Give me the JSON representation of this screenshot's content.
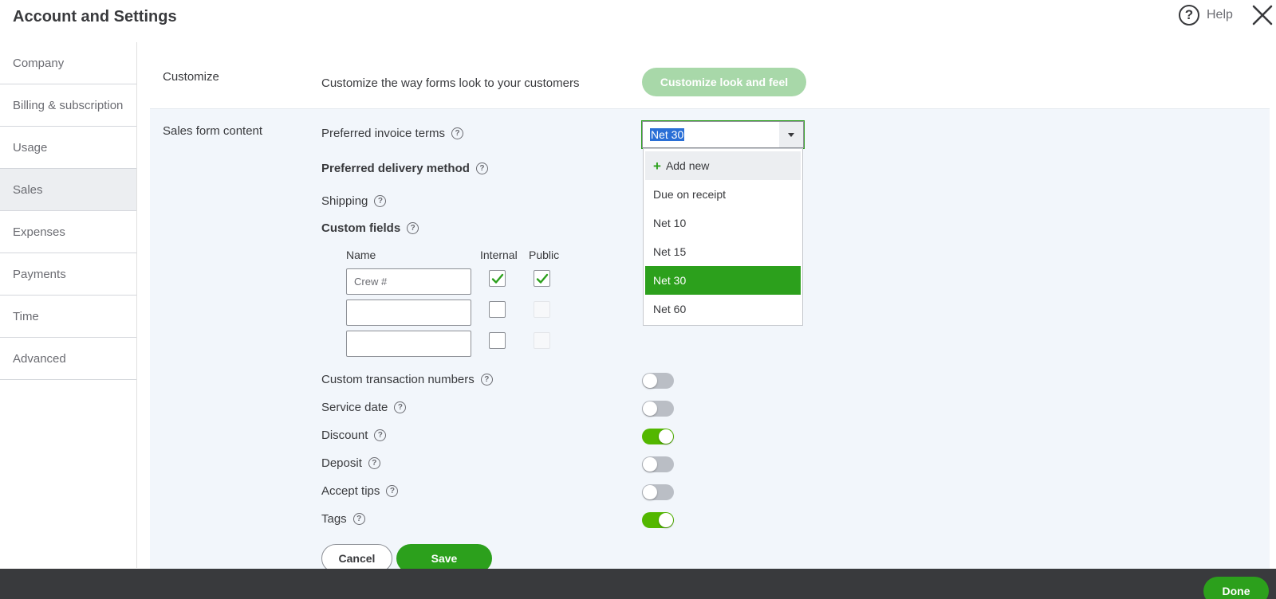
{
  "page_title": "Account and Settings",
  "header": {
    "help_label": "Help",
    "help_icon": "question-circle-icon",
    "close_icon": "close-icon"
  },
  "sidebar": {
    "items": [
      {
        "label": "Company"
      },
      {
        "label": "Billing & subscription"
      },
      {
        "label": "Usage"
      },
      {
        "label": "Sales",
        "active": true
      },
      {
        "label": "Expenses"
      },
      {
        "label": "Payments"
      },
      {
        "label": "Time"
      },
      {
        "label": "Advanced"
      }
    ]
  },
  "customize": {
    "section_label": "Customize",
    "description": "Customize the way forms look to your customers",
    "button_label": "Customize look and feel"
  },
  "sales_form": {
    "section_label": "Sales form content",
    "invoice_terms": {
      "label": "Preferred invoice terms",
      "value": "Net 30",
      "options": [
        "Add new",
        "Due on receipt",
        "Net 10",
        "Net 15",
        "Net 30",
        "Net 60"
      ],
      "selected": "Net 30"
    },
    "delivery_method_label": "Preferred delivery method",
    "shipping_label": "Shipping",
    "custom_fields": {
      "label": "Custom fields",
      "col_name": "Name",
      "col_internal": "Internal",
      "col_public": "Public",
      "rows": [
        {
          "name": "Crew #",
          "internal": true,
          "public": true
        },
        {
          "name": "",
          "internal": false,
          "public": false
        },
        {
          "name": "",
          "internal": false,
          "public": false
        }
      ]
    },
    "toggles": [
      {
        "label": "Custom transaction numbers",
        "on": false
      },
      {
        "label": "Service date",
        "on": false
      },
      {
        "label": "Discount",
        "on": true
      },
      {
        "label": "Deposit",
        "on": false
      },
      {
        "label": "Accept tips",
        "on": false
      },
      {
        "label": "Tags",
        "on": true
      }
    ],
    "cancel_label": "Cancel",
    "save_label": "Save"
  },
  "footer": {
    "done_label": "Done"
  },
  "colors": {
    "accent_green": "#2ca01c",
    "toggle_on": "#53b700",
    "toggle_off": "#babec5",
    "panel_bg": "#f2f6fb",
    "footer_bg": "#393a3d"
  }
}
